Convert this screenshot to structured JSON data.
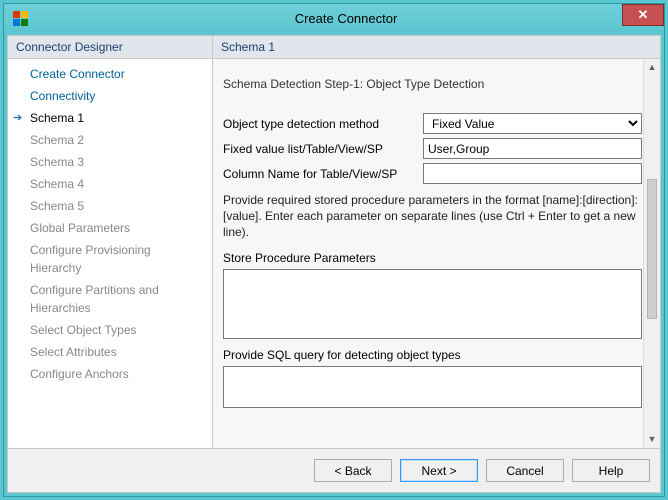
{
  "window": {
    "title": "Create Connector",
    "close": "✕"
  },
  "nav": {
    "header": "Connector Designer",
    "items": [
      {
        "label": "Create Connector",
        "state": "link"
      },
      {
        "label": "Connectivity",
        "state": "link"
      },
      {
        "label": "Schema 1",
        "state": "active"
      },
      {
        "label": "Schema 2",
        "state": "dim"
      },
      {
        "label": "Schema 3",
        "state": "dim"
      },
      {
        "label": "Schema 4",
        "state": "dim"
      },
      {
        "label": "Schema 5",
        "state": "dim"
      },
      {
        "label": "Global Parameters",
        "state": "dim"
      },
      {
        "label": "Configure Provisioning Hierarchy",
        "state": "dim"
      },
      {
        "label": "Configure Partitions and Hierarchies",
        "state": "dim"
      },
      {
        "label": "Select Object Types",
        "state": "dim"
      },
      {
        "label": "Select Attributes",
        "state": "dim"
      },
      {
        "label": "Configure Anchors",
        "state": "dim"
      }
    ]
  },
  "content": {
    "header": "Schema 1",
    "section_title": "Schema Detection Step-1: Object Type Detection",
    "fields": {
      "method_label": "Object type detection method",
      "method_value": "Fixed Value",
      "fixed_list_label": "Fixed value list/Table/View/SP",
      "fixed_list_value": "User,Group",
      "column_label": "Column Name for Table/View/SP",
      "column_value": ""
    },
    "hint": "Provide required stored procedure parameters in the format [name]:[direction]:[value]. Enter each parameter on separate lines (use Ctrl + Enter to get a new line).",
    "sp_label": "Store Procedure Parameters",
    "sp_value": "",
    "sql_label": "Provide SQL query for detecting object types",
    "sql_value": ""
  },
  "footer": {
    "back": "<  Back",
    "next": "Next  >",
    "cancel": "Cancel",
    "help": "Help"
  }
}
